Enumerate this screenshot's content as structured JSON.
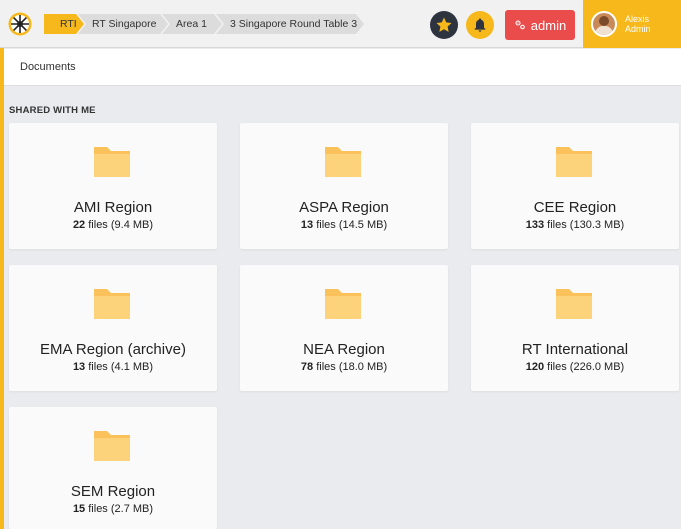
{
  "breadcrumbs": [
    "RTI",
    "RT Singapore",
    "Area 1",
    "3 Singapore Round Table 3"
  ],
  "header": {
    "admin_label": "admin",
    "user_first": "Alexis",
    "user_role": "Admin"
  },
  "subheader": {
    "title": "Documents"
  },
  "section": {
    "title": "SHARED WITH ME"
  },
  "folders": [
    {
      "name": "AMI Region",
      "count": "22",
      "size": " files (9.4 MB)"
    },
    {
      "name": "ASPA Region",
      "count": "13",
      "size": " files (14.5 MB)"
    },
    {
      "name": "CEE Region",
      "count": "133",
      "size": " files (130.3 MB)"
    },
    {
      "name": "EMA Region (archive)",
      "count": "13",
      "size": " files (4.1 MB)"
    },
    {
      "name": "NEA Region",
      "count": "78",
      "size": " files (18.0 MB)"
    },
    {
      "name": "RT International",
      "count": "120",
      "size": " files (226.0 MB)"
    },
    {
      "name": "SEM Region",
      "count": "15",
      "size": " files (2.7 MB)"
    }
  ],
  "colors": {
    "accent": "#f6b81a",
    "admin_button": "#ea4c4c",
    "star_button": "#2e3340",
    "folder": "#fbc15a"
  },
  "icons": [
    "round-table-logo-icon",
    "star-icon",
    "bell-icon",
    "users-cog-icon",
    "folder-icon"
  ]
}
